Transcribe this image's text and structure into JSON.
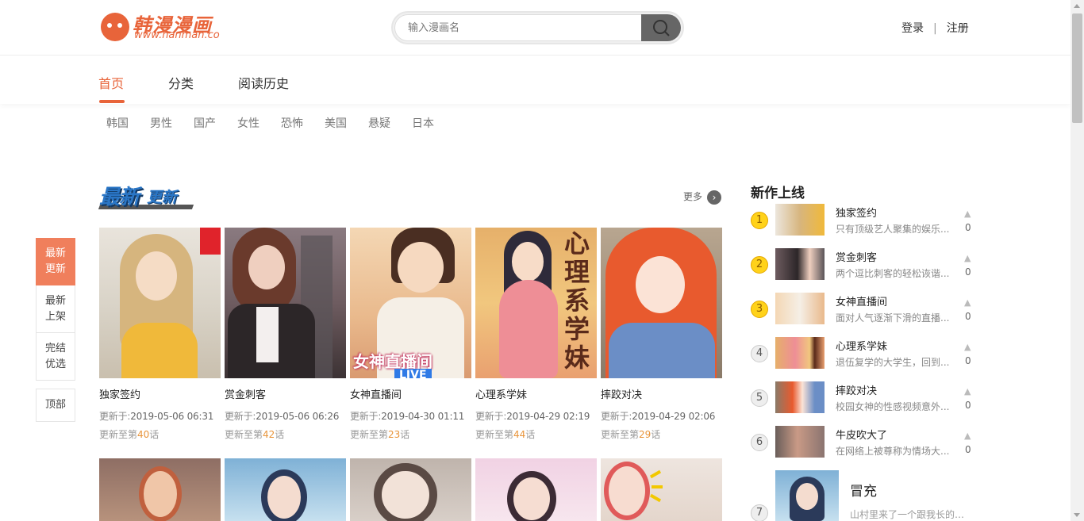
{
  "header": {
    "logo_text": "韩漫漫画",
    "logo_url": "www.hanman.co",
    "search_placeholder": "输入漫画名",
    "login": "登录",
    "separator": "|",
    "register": "注册"
  },
  "nav": {
    "tabs": [
      {
        "label": "首页",
        "active": true
      },
      {
        "label": "分类",
        "active": false
      },
      {
        "label": "阅读历史",
        "active": false
      }
    ],
    "accent_color": "#e8643a"
  },
  "categories": [
    "韩国",
    "男性",
    "国产",
    "女性",
    "恐怖",
    "美国",
    "悬疑",
    "日本"
  ],
  "float_menu": {
    "items": [
      {
        "label": "最新更新",
        "active": true
      },
      {
        "label": "最新上架",
        "active": false
      },
      {
        "label": "完结优选",
        "active": false
      }
    ],
    "top_label": "顶部"
  },
  "latest": {
    "title_main": "最新",
    "title_sub": "更新",
    "more": "更多",
    "update_prefix": "更新于:",
    "ep_prefix": "更新至第",
    "ep_suffix": "话",
    "comics": [
      {
        "title": "独家签约",
        "updated": "2019-05-06 06:31",
        "episode": "40"
      },
      {
        "title": "赏金刺客",
        "updated": "2019-05-06 06:26",
        "episode": "42"
      },
      {
        "title": "女神直播间",
        "updated": "2019-04-30 01:11",
        "episode": "23",
        "cover_text": "女神直播间",
        "cover_badge": "LIVE"
      },
      {
        "title": "心理系学妹",
        "updated": "2019-04-29 02:19",
        "episode": "44",
        "cover_text": "心理系学妹"
      },
      {
        "title": "摔跤对决",
        "updated": "2019-04-29 02:06",
        "episode": "29"
      }
    ]
  },
  "new_releases": {
    "title": "新作上线",
    "items": [
      {
        "rank": "1",
        "name": "独家签约",
        "desc": "只有顶级艺人聚集的娱乐...",
        "count": "0"
      },
      {
        "rank": "2",
        "name": "赏金刺客",
        "desc": "两个逗比刺客的轻松诙谐...",
        "count": "0"
      },
      {
        "rank": "3",
        "name": "女神直播间",
        "desc": "面对人气逐渐下滑的直播...",
        "count": "0"
      },
      {
        "rank": "4",
        "name": "心理系学妹",
        "desc": "退伍复学的大学生，回到...",
        "count": "0"
      },
      {
        "rank": "5",
        "name": "摔跤对决",
        "desc": "校园女神的性感视频意外...",
        "count": "0"
      },
      {
        "rank": "6",
        "name": "牛皮吹大了",
        "desc": "在网络上被尊称为情场大...",
        "count": "0"
      }
    ],
    "featured": {
      "rank": "7",
      "name": "冒充",
      "desc": "山村里来了一个跟我长的一..."
    }
  }
}
